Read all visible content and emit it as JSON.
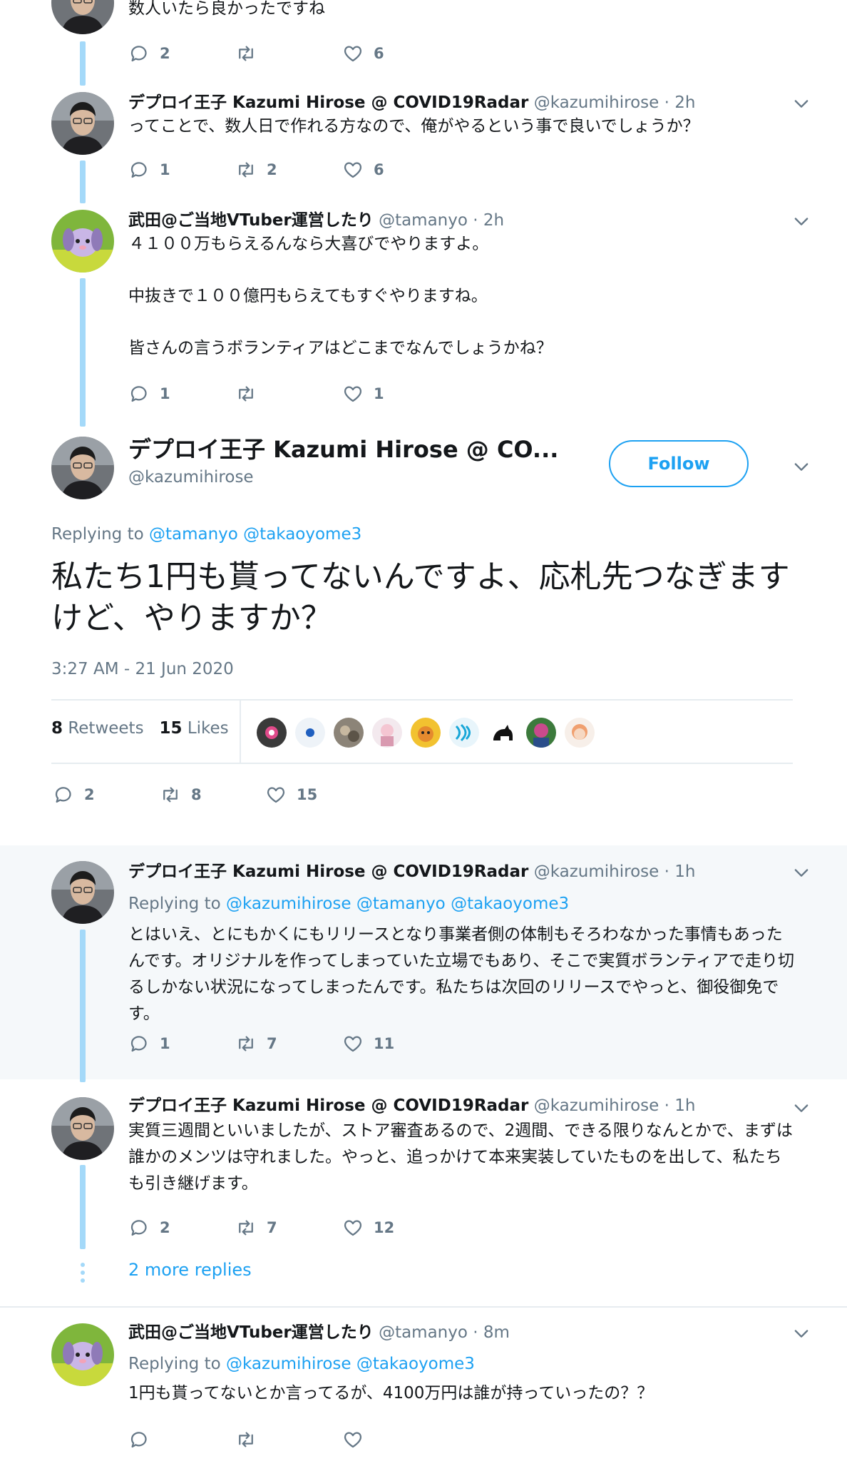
{
  "tweets": [
    {
      "text": "数人いたら良かったですね",
      "replies": "2",
      "retweets": "",
      "likes": "6"
    },
    {
      "name": "デプロイ王子 Kazumi Hirose @ COVID19Radar",
      "handle": "@kazumihirose",
      "time": "2h",
      "text": "ってことで、数人日で作れる方なので、俺がやるという事で良いでしょうか？",
      "replies": "1",
      "retweets": "2",
      "likes": "6"
    },
    {
      "name": "武田@ご当地VTuber運営したり",
      "handle": "@tamanyo",
      "time": "2h",
      "paragraphs": [
        "４１００万もらえるんなら大喜びでやりますよ。",
        "中抜きで１００億円もらえてもすぐやりますね。",
        "皆さんの言うボランティアはどこまでなんでしょうかね？"
      ],
      "replies": "1",
      "retweets": "",
      "likes": "1"
    }
  ],
  "main_tweet": {
    "name": "デプロイ王子 Kazumi Hirose @ CO...",
    "handle": "@kazumihirose",
    "follow_label": "Follow",
    "replying_label": "Replying to",
    "replying_to": [
      "@tamanyo",
      "@takaoyome3"
    ],
    "text": "私たち1円も貰ってないんですよ、応札先つなぎますけど、やりますか？",
    "timestamp": "3:27 AM - 21 Jun 2020",
    "retweet_count": "8",
    "retweet_label": "Retweets",
    "like_count": "15",
    "like_label": "Likes",
    "replies": "2",
    "retweets": "8",
    "likes": "15"
  },
  "replies": [
    {
      "name": "デプロイ王子 Kazumi Hirose @ COVID19Radar",
      "handle": "@kazumihirose",
      "time": "1h",
      "replying_label": "Replying to",
      "replying_to": [
        "@kazumihirose",
        "@tamanyo",
        "@takaoyome3"
      ],
      "text": "とはいえ、とにもかくにもリリースとなり事業者側の体制もそろわなかった事情もあったんです。オリジナルを作ってしまっていた立場でもあり、そこで実質ボランティアで走り切るしかない状況になってしまったんです。私たちは次回のリリースでやっと、御役御免です。",
      "replies": "1",
      "retweets": "7",
      "likes": "11"
    },
    {
      "name": "デプロイ王子 Kazumi Hirose @ COVID19Radar",
      "handle": "@kazumihirose",
      "time": "1h",
      "text": "実質三週間といいましたが、ストア審査あるので、2週間、できる限りなんとかで、まずは誰かのメンツは守れました。やっと、追っかけて本来実装していたものを出して、私たちも引き継げます。",
      "replies": "2",
      "retweets": "7",
      "likes": "12"
    },
    {
      "name": "武田@ご当地VTuber運営したり",
      "handle": "@tamanyo",
      "time": "8m",
      "replying_label": "Replying to",
      "replying_to": [
        "@kazumihirose",
        "@takaoyome3"
      ],
      "text": "1円も貰ってないとか言ってるが、4100万円は誰が持っていったの？？",
      "replies": "",
      "retweets": "",
      "likes": ""
    }
  ],
  "more_replies": "2 more replies",
  "dot": "·",
  "colors": {
    "accent": "#1da1f2",
    "muted": "#657786",
    "thread": "#a4d9f9",
    "highlight_bg": "#f5f8fa"
  },
  "icons": [
    "reply-icon",
    "retweet-icon",
    "like-icon",
    "caret-down-icon"
  ]
}
